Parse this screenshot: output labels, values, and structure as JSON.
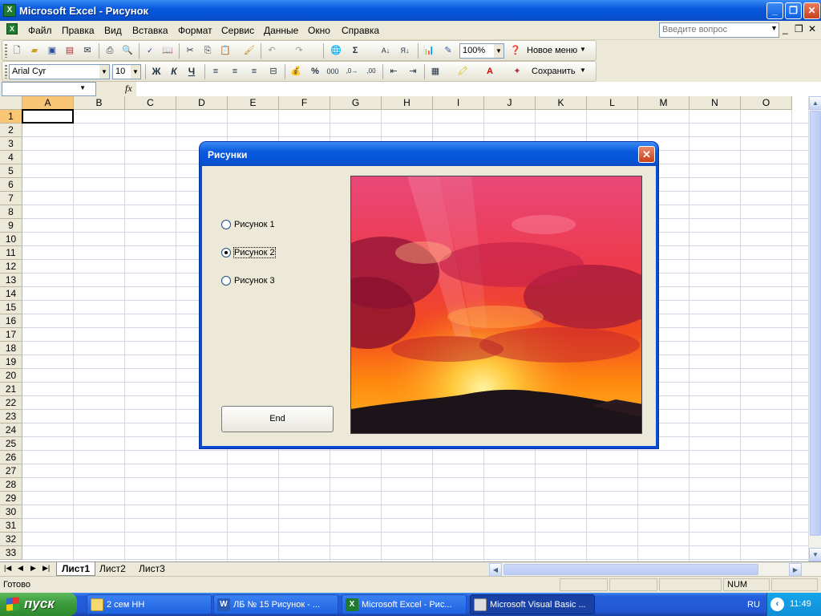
{
  "window": {
    "title": "Microsoft Excel - Рисунок"
  },
  "menu": {
    "items": [
      "Файл",
      "Правка",
      "Вид",
      "Вставка",
      "Формат",
      "Сервис",
      "Данные",
      "Окно",
      "Справка"
    ],
    "ask_placeholder": "Введите вопрос"
  },
  "toolbar1": {
    "zoom": "100%",
    "new_menu": "Новое меню"
  },
  "toolbar2": {
    "font_name": "Arial Cyr",
    "font_size": "10",
    "bold": "Ж",
    "italic": "К",
    "underline": "Ч",
    "save_label": "Сохранить"
  },
  "formula_bar": {
    "name_box": "",
    "fx": "fx",
    "value": ""
  },
  "grid": {
    "columns": [
      "A",
      "B",
      "C",
      "D",
      "E",
      "F",
      "G",
      "H",
      "I",
      "J",
      "K",
      "L",
      "M",
      "N",
      "O"
    ],
    "rows": [
      "1",
      "2",
      "3",
      "4",
      "5",
      "6",
      "7",
      "8",
      "9",
      "10",
      "11",
      "12",
      "13",
      "14",
      "15",
      "16",
      "17",
      "18",
      "19",
      "20",
      "21",
      "22",
      "23",
      "24",
      "25",
      "26",
      "27",
      "28",
      "29",
      "30",
      "31",
      "32",
      "33"
    ],
    "active_cell": "A1"
  },
  "sheets": [
    "Лист1",
    "Лист2",
    "Лист3"
  ],
  "status": {
    "ready": "Готово",
    "num": "NUM"
  },
  "dialog": {
    "title": "Рисунки",
    "options": [
      {
        "label": "Рисунок 1",
        "selected": false
      },
      {
        "label": "Рисунок 2",
        "selected": true
      },
      {
        "label": "Рисунок 3",
        "selected": false
      }
    ],
    "end_button": "End",
    "image_subject": "sunset"
  },
  "taskbar": {
    "start": "пуск",
    "items": [
      {
        "label": "2 сем НН",
        "icon": "folder-icon"
      },
      {
        "label": "ЛБ № 15 Рисунок - ...",
        "icon": "word-icon"
      },
      {
        "label": "Microsoft Excel - Рис...",
        "icon": "excel-icon"
      },
      {
        "label": "Microsoft Visual Basic ...",
        "icon": "vba-icon"
      }
    ],
    "lang": "RU",
    "clock": "11:49"
  },
  "colors": {
    "xp_blue": "#0a5ade",
    "active_header": "#f9c675",
    "grid_line": "#d0d7e5"
  }
}
